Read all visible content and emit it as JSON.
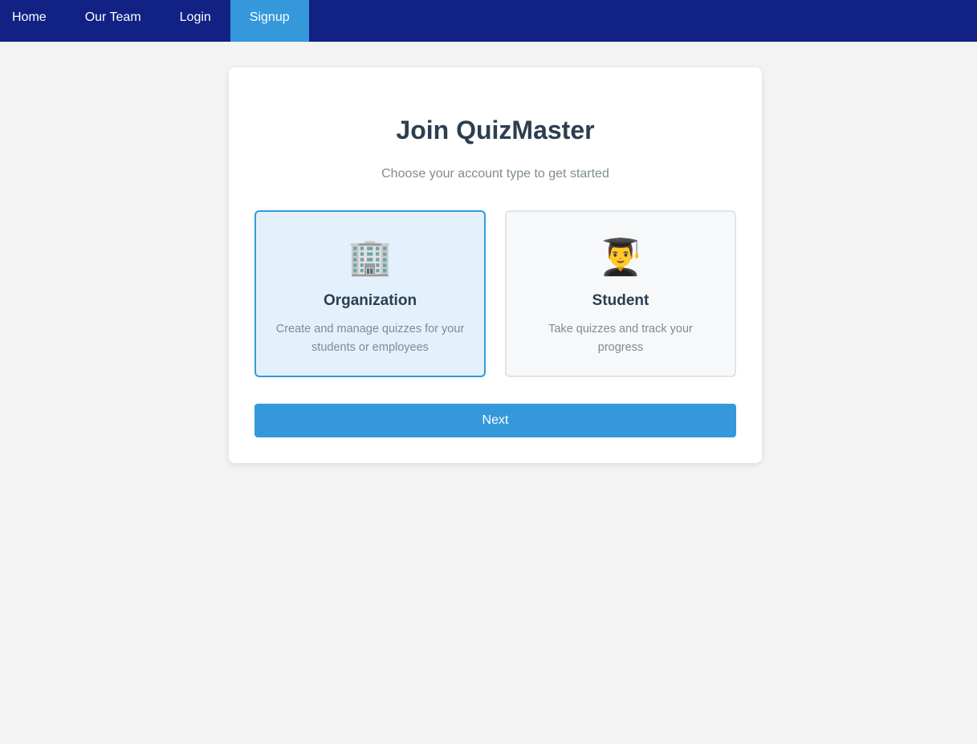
{
  "nav": {
    "items": [
      {
        "label": "Home"
      },
      {
        "label": "Our Team"
      },
      {
        "label": "Login"
      },
      {
        "label": "Signup",
        "active": true
      }
    ]
  },
  "signup": {
    "title": "Join QuizMaster",
    "subtitle": "Choose your account type to get started",
    "options": [
      {
        "icon": "🏢",
        "icon_name": "office-building-icon",
        "title": "Organization",
        "description": "Create and manage quizzes for your students or employees",
        "selected": true
      },
      {
        "icon": "👨‍🎓",
        "icon_name": "student-graduate-icon",
        "title": "Student",
        "description": "Take quizzes and track your progress",
        "selected": false
      }
    ],
    "next_label": "Next"
  },
  "colors": {
    "navbar": "#112284",
    "active_tab": "#3498db",
    "primary": "#3498db",
    "selected_bg": "#e3f1fc"
  }
}
